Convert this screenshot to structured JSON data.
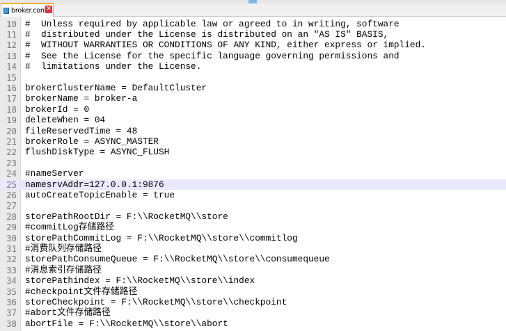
{
  "tab": {
    "filename": "broker.conf",
    "close_glyph": "✕"
  },
  "editor": {
    "current_line": 25,
    "lines": [
      {
        "num": "10",
        "text": "#  Unless required by applicable law or agreed to in writing, software"
      },
      {
        "num": "11",
        "text": "#  distributed under the License is distributed on an \"AS IS\" BASIS,"
      },
      {
        "num": "12",
        "text": "#  WITHOUT WARRANTIES OR CONDITIONS OF ANY KIND, either express or implied."
      },
      {
        "num": "13",
        "text": "#  See the License for the specific language governing permissions and"
      },
      {
        "num": "14",
        "text": "#  limitations under the License."
      },
      {
        "num": "15",
        "text": ""
      },
      {
        "num": "16",
        "text": "brokerClusterName = DefaultCluster"
      },
      {
        "num": "17",
        "text": "brokerName = broker-a"
      },
      {
        "num": "18",
        "text": "brokerId = 0"
      },
      {
        "num": "19",
        "text": "deleteWhen = 04"
      },
      {
        "num": "20",
        "text": "fileReservedTime = 48"
      },
      {
        "num": "21",
        "text": "brokerRole = ASYNC_MASTER"
      },
      {
        "num": "22",
        "text": "flushDiskType = ASYNC_FLUSH"
      },
      {
        "num": "23",
        "text": ""
      },
      {
        "num": "24",
        "text": "#nameServer"
      },
      {
        "num": "25",
        "text": "namesrvAddr=127.0.0.1:9876"
      },
      {
        "num": "26",
        "text": "autoCreateTopicEnable = true"
      },
      {
        "num": "27",
        "text": ""
      },
      {
        "num": "28",
        "text": "storePathRootDir = F:\\\\RocketMQ\\\\store"
      },
      {
        "num": "29",
        "text": "#commitLog存储路径"
      },
      {
        "num": "30",
        "text": "storePathCommitLog = F:\\\\RocketMQ\\\\store\\\\commitlog"
      },
      {
        "num": "31",
        "text": "#消费队列存储路径"
      },
      {
        "num": "32",
        "text": "storePathConsumeQueue = F:\\\\RocketMQ\\\\store\\\\consumequeue"
      },
      {
        "num": "33",
        "text": "#消息索引存储路径"
      },
      {
        "num": "34",
        "text": "storePathindex = F:\\\\RocketMQ\\\\store\\\\index"
      },
      {
        "num": "35",
        "text": "#checkpoint文件存储路径"
      },
      {
        "num": "36",
        "text": "storeCheckpoint = F:\\\\RocketMQ\\\\store\\\\checkpoint"
      },
      {
        "num": "37",
        "text": "#abort文件存储路径"
      },
      {
        "num": "38",
        "text": "abortFile = F:\\\\RocketMQ\\\\store\\\\abort"
      }
    ]
  }
}
